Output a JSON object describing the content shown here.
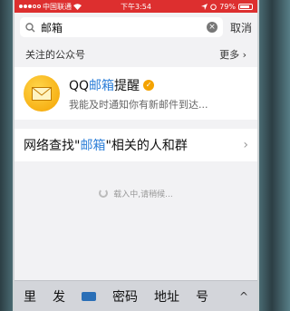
{
  "status": {
    "carrier": "中国联通",
    "time": "下午3:54",
    "battery": "79%"
  },
  "search": {
    "query": "邮箱",
    "cancel": "取消"
  },
  "section": {
    "title": "关注的公众号",
    "more": "更多"
  },
  "account": {
    "name_prefix": "QQ",
    "name_highlight": "邮箱",
    "name_suffix": "提醒",
    "description": "我能及时通知你有新邮件到达..."
  },
  "network_search": {
    "prefix": "网络查找\"",
    "highlight": "邮箱",
    "suffix": "\"相关的人和群"
  },
  "loading_text": "载入中,请稍候...",
  "keyboard": {
    "candidates": [
      "里",
      "发",
      "密码",
      "地址",
      "号"
    ],
    "expand": "^"
  },
  "colors": {
    "statusbar": "#dd2f2f",
    "highlight": "#2d7fd8",
    "logo": "#f4a300"
  },
  "icons": [
    "wifi-icon",
    "search-icon",
    "clear-icon",
    "chevron-right-icon",
    "mail-icon",
    "verified-icon",
    "spinner-icon",
    "keyboard-emoji-icon"
  ]
}
